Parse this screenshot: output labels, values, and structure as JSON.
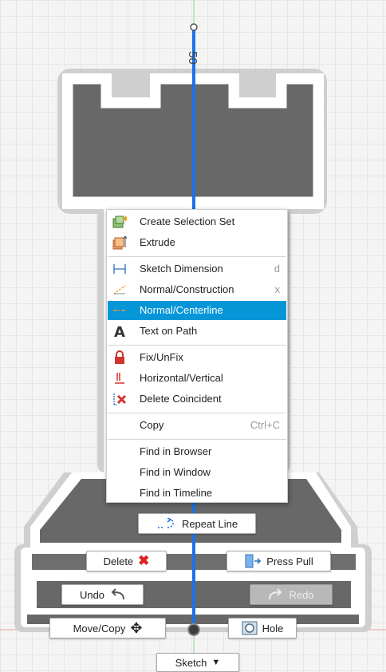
{
  "dimension": {
    "value": "50"
  },
  "colors": {
    "accent": "#0696d7",
    "rook_fill": "#686868",
    "rook_outline": "#ffffff",
    "sketch_line": "#1a73e8"
  },
  "context_menu": {
    "groups": [
      [
        {
          "label": "Create Selection Set",
          "icon": "selection-set-icon",
          "shortcut": ""
        },
        {
          "label": "Extrude",
          "icon": "extrude-icon",
          "shortcut": ""
        }
      ],
      [
        {
          "label": "Sketch Dimension",
          "icon": "sketch-dimension-icon",
          "shortcut": "d"
        },
        {
          "label": "Normal/Construction",
          "icon": "construction-icon",
          "shortcut": "x"
        },
        {
          "label": "Normal/Centerline",
          "icon": "centerline-icon",
          "shortcut": "",
          "selected": true
        },
        {
          "label": "Text on Path",
          "icon": "text-on-path-icon",
          "shortcut": ""
        }
      ],
      [
        {
          "label": "Fix/UnFix",
          "icon": "lock-icon",
          "shortcut": ""
        },
        {
          "label": "Horizontal/Vertical",
          "icon": "horizontal-vertical-icon",
          "shortcut": ""
        },
        {
          "label": "Delete Coincident",
          "icon": "delete-coincident-icon",
          "shortcut": ""
        }
      ],
      [
        {
          "label": "Copy",
          "icon": "",
          "shortcut": "Ctrl+C"
        }
      ],
      [
        {
          "label": "Find in Browser",
          "icon": "",
          "shortcut": ""
        },
        {
          "label": "Find in Window",
          "icon": "",
          "shortcut": ""
        },
        {
          "label": "Find in Timeline",
          "icon": "",
          "shortcut": ""
        }
      ]
    ]
  },
  "marking_menu": {
    "repeat": {
      "label": "Repeat Line",
      "icon": "repeat-line-icon"
    },
    "delete": {
      "label": "Delete",
      "icon": "red-x-icon"
    },
    "press_pull": {
      "label": "Press Pull",
      "icon": "press-pull-icon"
    },
    "undo": {
      "label": "Undo",
      "icon": "undo-arrow-icon"
    },
    "redo": {
      "label": "Redo",
      "icon": "redo-arrow-icon",
      "disabled": true
    },
    "move_copy": {
      "label": "Move/Copy",
      "icon": "move-arrows-icon"
    },
    "hole": {
      "label": "Hole",
      "icon": "hole-icon"
    },
    "sketch": {
      "label": "Sketch",
      "icon": "dropdown-arrow-icon"
    }
  }
}
